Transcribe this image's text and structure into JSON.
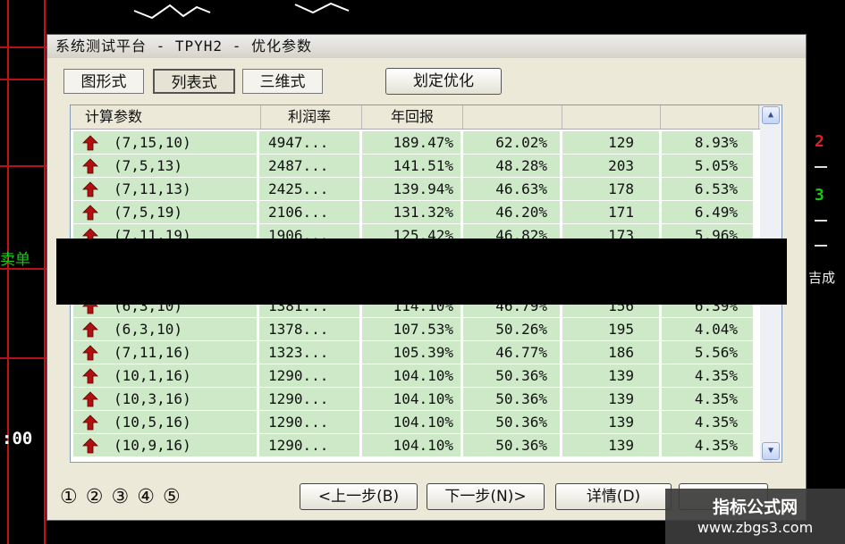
{
  "background": {
    "sell_label": "卖单",
    "time_label": ":00",
    "right_numbers": [
      "2",
      "3"
    ],
    "right_text": "吉成"
  },
  "dialog": {
    "title": "系统测试平台 - TPYH2 - 优化参数",
    "view_tabs": [
      "图形式",
      "列表式",
      "三维式"
    ],
    "active_tab": "列表式",
    "optimize_button": "划定优化"
  },
  "table": {
    "headers": [
      "计算参数",
      "利润率",
      "年回报",
      "",
      "",
      ""
    ],
    "rows": [
      [
        "(7,15,10)",
        "4947...",
        "189.47%",
        "62.02%",
        "129",
        "8.93%"
      ],
      [
        "(7,5,13)",
        "2487...",
        "141.51%",
        "48.28%",
        "203",
        "5.05%"
      ],
      [
        "(7,11,13)",
        "2425...",
        "139.94%",
        "46.63%",
        "178",
        "6.53%"
      ],
      [
        "(7,5,19)",
        "2106...",
        "131.32%",
        "46.20%",
        "171",
        "6.49%"
      ],
      [
        "(7,11,19)",
        "1906...",
        "125.42%",
        "46.82%",
        "173",
        "5.96%"
      ],
      [
        "",
        "",
        "",
        "",
        "",
        ""
      ],
      [
        "",
        "",
        "",
        "",
        "",
        ""
      ],
      [
        "(6,3,10)",
        "1381...",
        "114.10%",
        "46.79%",
        "156",
        "6.39%"
      ],
      [
        "(6,3,10)",
        "1378...",
        "107.53%",
        "50.26%",
        "195",
        "4.04%"
      ],
      [
        "(7,11,16)",
        "1323...",
        "105.39%",
        "46.77%",
        "186",
        "5.56%"
      ],
      [
        "(10,1,16)",
        "1290...",
        "104.10%",
        "50.36%",
        "139",
        "4.35%"
      ],
      [
        "(10,3,16)",
        "1290...",
        "104.10%",
        "50.36%",
        "139",
        "4.35%"
      ],
      [
        "(10,5,16)",
        "1290...",
        "104.10%",
        "50.36%",
        "139",
        "4.35%"
      ],
      [
        "(10,9,16)",
        "1290...",
        "104.10%",
        "50.36%",
        "139",
        "4.35%"
      ]
    ]
  },
  "footer": {
    "steps": [
      "①",
      "②",
      "③",
      "④",
      "⑤"
    ],
    "prev_button": "<上一步(B)",
    "next_button": "下一步(N)>",
    "detail_button": "详情(D)"
  },
  "watermark": {
    "title": "指标公式网",
    "url": "www.zbgs3.com"
  },
  "colors": {
    "row_bg": "#cde9c8",
    "grid_red": "#c8101a",
    "arrow_red": "#b01010",
    "dialog_bg": "#ece9d8"
  },
  "icons": {
    "row_marker": "red-up-arrow-icon",
    "scroll_up": "scroll-up-icon",
    "scroll_down": "scroll-down-icon"
  }
}
